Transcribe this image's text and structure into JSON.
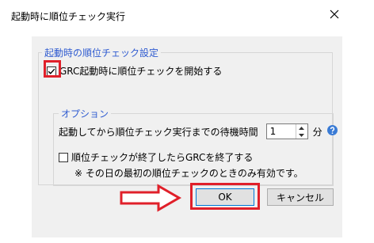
{
  "window": {
    "title": "起動時に順位チェック実行",
    "close_glyph": "✕"
  },
  "startup_group": {
    "title": "起動時の順位チェック設定",
    "start_checkbox": {
      "label": "GRC起動時に順位チェックを開始する",
      "checked": true
    }
  },
  "options_group": {
    "title": "オプション",
    "wait_label": "起動してから順位チェック実行までの待機時間",
    "wait_value": "1",
    "wait_unit": "分",
    "end_checkbox": {
      "label": "順位チェックが終了したらGRCを終了する",
      "checked": false
    },
    "note": "※ その日の最初の順位チェックのときのみ有効です。"
  },
  "buttons": {
    "ok_label": "OK",
    "cancel_label": "キャンセル"
  },
  "colors": {
    "group_title": "#2f5bd0",
    "highlight": "#e0202a",
    "help_icon": "#3a7bd5"
  }
}
